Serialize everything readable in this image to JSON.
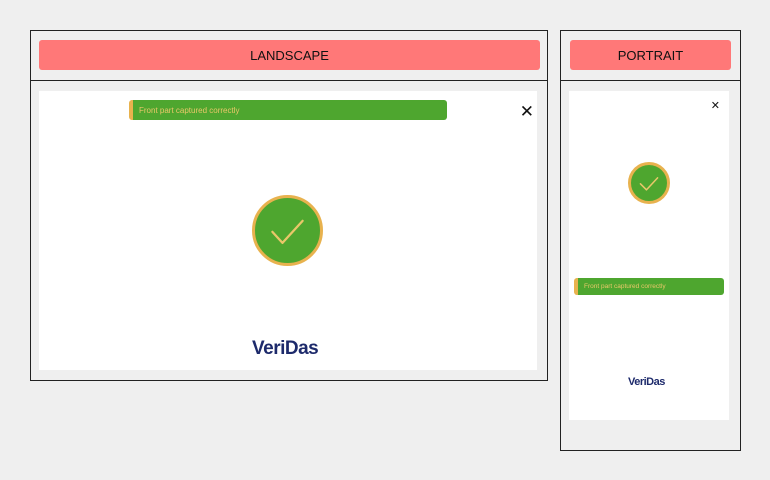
{
  "landscape": {
    "header_label": "LANDSCAPE",
    "toast_text": "Front part captured correctly",
    "close_glyph": "✕",
    "logo_text": "VeriDas"
  },
  "portrait": {
    "header_label": "PORTRAIT",
    "toast_text": "Front part captured correctly",
    "close_glyph": "✕",
    "logo_text": "VeriDas"
  },
  "colors": {
    "header_button": "#ff7878",
    "success_green": "#4ea62f",
    "accent_orange": "#e8b24e",
    "logo_navy": "#1d2a6b"
  },
  "icons": {
    "check": "checkmark-icon",
    "close": "close-icon"
  }
}
